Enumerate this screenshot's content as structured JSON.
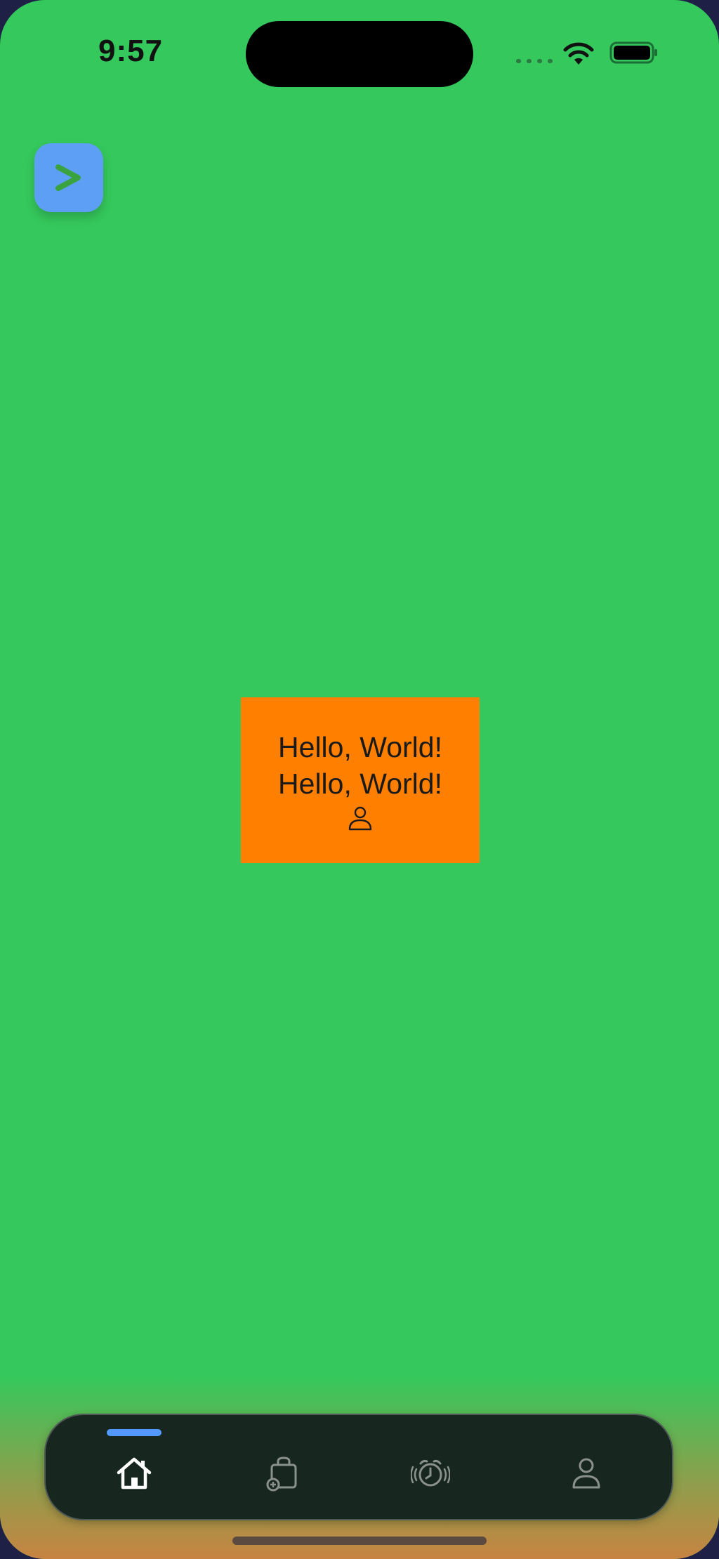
{
  "status_bar": {
    "time": "9:57",
    "wifi_icon": "wifi-icon",
    "battery_icon": "battery-icon"
  },
  "colors": {
    "background": "#35c85c",
    "card": "#ff7f00",
    "menu_button": "#5d9ff4",
    "tab_bar": "#172720",
    "tab_active_indicator": "#5199ff"
  },
  "menu_button": {
    "icon": "chevron-right-icon"
  },
  "card": {
    "line1": "Hello, World!",
    "line2": "Hello, World!",
    "icon": "person-icon"
  },
  "tab_bar": {
    "active_index": 0,
    "tabs": [
      {
        "icon": "home-icon",
        "active": true
      },
      {
        "icon": "bag-add-icon",
        "active": false
      },
      {
        "icon": "alarm-clock-icon",
        "active": false
      },
      {
        "icon": "person-icon",
        "active": false
      }
    ]
  }
}
